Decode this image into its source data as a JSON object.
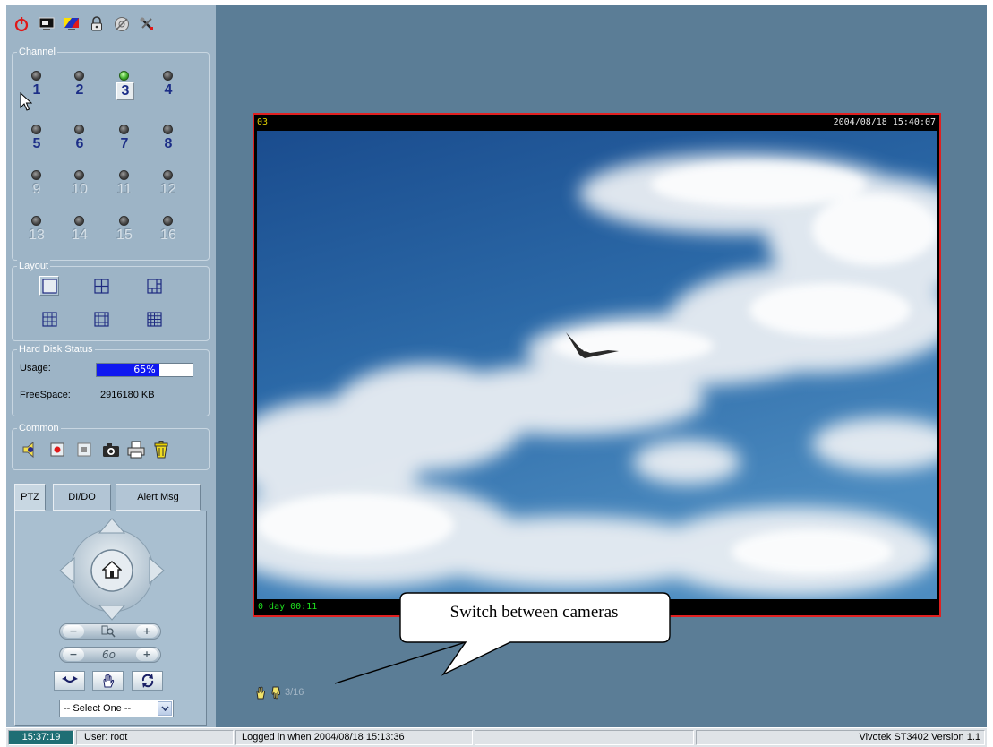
{
  "toolbar": {
    "icons": [
      "power-icon",
      "display-icon",
      "color-display-icon",
      "lock-icon",
      "settings-disc-icon",
      "tools-icon"
    ]
  },
  "channel": {
    "title": "Channel",
    "items": [
      {
        "label": "1",
        "led": "off",
        "enabled": true
      },
      {
        "label": "2",
        "led": "off",
        "enabled": true
      },
      {
        "label": "3",
        "led": "on",
        "enabled": true,
        "selected": true
      },
      {
        "label": "4",
        "led": "off",
        "enabled": true
      },
      {
        "label": "5",
        "led": "off",
        "enabled": true
      },
      {
        "label": "6",
        "led": "off",
        "enabled": true
      },
      {
        "label": "7",
        "led": "off",
        "enabled": true
      },
      {
        "label": "8",
        "led": "off",
        "enabled": true
      },
      {
        "label": "9",
        "led": "off",
        "enabled": false
      },
      {
        "label": "10",
        "led": "off",
        "enabled": false
      },
      {
        "label": "11",
        "led": "off",
        "enabled": false
      },
      {
        "label": "12",
        "led": "off",
        "enabled": false
      },
      {
        "label": "13",
        "led": "off",
        "enabled": false
      },
      {
        "label": "14",
        "led": "off",
        "enabled": false
      },
      {
        "label": "15",
        "led": "off",
        "enabled": false
      },
      {
        "label": "16",
        "led": "off",
        "enabled": false
      }
    ]
  },
  "layout": {
    "title": "Layout",
    "options": [
      "single-view-icon",
      "quad-view-icon",
      "six-view-icon",
      "nine-view-icon",
      "ten-view-icon",
      "sixteen-view-icon"
    ],
    "selected": "single-view-icon"
  },
  "hard_disk": {
    "title": "Hard Disk Status",
    "usage_label": "Usage:",
    "usage_value": "65%",
    "usage_fraction": 0.65,
    "free_label": "FreeSpace:",
    "free_value": "2916180 KB"
  },
  "common": {
    "title": "Common",
    "icons": [
      "speaker-icon",
      "record-icon",
      "stop-record-icon",
      "camera-snapshot-icon",
      "print-icon",
      "trash-icon"
    ]
  },
  "tabs": [
    {
      "label": "PTZ",
      "active": true
    },
    {
      "label": "DI/DO",
      "active": false
    },
    {
      "label": "Alert Msg",
      "active": false
    }
  ],
  "ptz": {
    "zoom": {
      "minus": "−",
      "plus": "+"
    },
    "focus": {
      "minus": "−",
      "plus": "+",
      "mid": "6o"
    },
    "preset_select": "-- Select One --"
  },
  "video": {
    "channel_label": "03",
    "timestamp": "2004/08/18 15:40:07",
    "uptime": "0 day  00:11"
  },
  "callout": {
    "text": "Switch between cameras"
  },
  "nav": {
    "count": "3/16"
  },
  "status_bar": {
    "time": "15:37:19",
    "user": "User: root",
    "login": "Logged in when  2004/08/18 15:13:36",
    "version": "Vivotek ST3402   Version 1.1"
  },
  "colors": {
    "background": "#5b7d96",
    "panel": "#9db4c6",
    "video_border": "#e02020",
    "usage_fill": "#1018f0",
    "status_time_bg": "#1e6e74"
  }
}
